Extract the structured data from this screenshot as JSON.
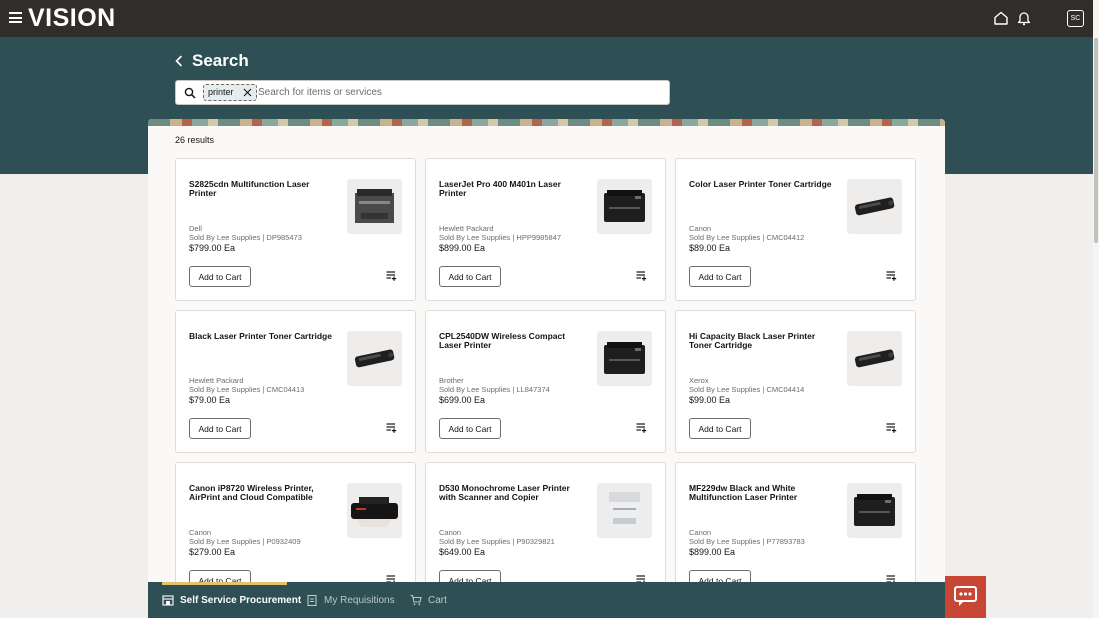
{
  "header": {
    "logo": "VISION",
    "avatar_initials": "SC",
    "icons": [
      "menu-icon",
      "home-icon",
      "bell-icon"
    ]
  },
  "search": {
    "title": "Search",
    "chip": "printer",
    "placeholder": "Search for items or services"
  },
  "results": {
    "count_label": "26 results",
    "items": [
      {
        "title": "S2825cdn Multifunction Laser Printer",
        "brand": "Dell",
        "seller": "Sold By Lee Supplies | DP985473",
        "price": "$799.00 Ea",
        "image": "laser-printer-grey",
        "button": "Add to Cart"
      },
      {
        "title": "LaserJet Pro 400 M401n Laser Printer",
        "brand": "Hewlett Packard",
        "seller": "Sold By Lee Supplies | HPP9985847",
        "price": "$899.00 Ea",
        "image": "laser-printer-black",
        "button": "Add to Cart"
      },
      {
        "title": "Color Laser Printer Toner Cartridge",
        "brand": "Canon",
        "seller": "Sold By Lee Supplies | CMC04412",
        "price": "$89.00 Ea",
        "image": "toner-cartridge",
        "button": "Add to Cart"
      },
      {
        "title": "Black Laser Printer Toner Cartridge",
        "brand": "Hewlett Packard",
        "seller": "Sold By Lee Supplies | CMC04413",
        "price": "$79.00 Ea",
        "image": "toner-cartridge",
        "button": "Add to Cart"
      },
      {
        "title": "CPL2540DW Wireless Compact Laser Printer",
        "brand": "Brother",
        "seller": "Sold By Lee Supplies | LL847374",
        "price": "$699.00 Ea",
        "image": "laser-printer-black",
        "button": "Add to Cart"
      },
      {
        "title": "Hi Capacity Black Laser Printer Toner Cartridge",
        "brand": "Xerox",
        "seller": "Sold By Lee Supplies | CMC04414",
        "price": "$99.00 Ea",
        "image": "toner-cartridge",
        "button": "Add to Cart"
      },
      {
        "title": "Canon iP8720 Wireless Printer, AirPrint and Cloud Compatible",
        "brand": "Canon",
        "seller": "Sold By Lee Supplies | P0932409",
        "price": "$279.00 Ea",
        "image": "inkjet-printer",
        "button": "Add to Cart"
      },
      {
        "title": "D530 Monochrome Laser Printer with Scanner and Copier",
        "brand": "Canon",
        "seller": "Sold By Lee Supplies | P90329821",
        "price": "$649.00 Ea",
        "image": "laser-printer-white",
        "button": "Add to Cart"
      },
      {
        "title": "MF229dw Black and White Multifunction Laser Printer",
        "brand": "Canon",
        "seller": "Sold By Lee Supplies | P77893783",
        "price": "$899.00 Ea",
        "image": "laser-printer-black",
        "button": "Add to Cart"
      }
    ]
  },
  "bottom_nav": {
    "tabs": [
      {
        "label": "Self Service Procurement",
        "icon": "store-icon",
        "active": true
      },
      {
        "label": "My Requisitions",
        "icon": "clipboard-icon",
        "active": false
      },
      {
        "label": "Cart",
        "icon": "cart-icon",
        "active": false
      }
    ]
  },
  "chat": {
    "icon": "chat-icon"
  },
  "colors": {
    "header": "#312d2a",
    "hero": "#2e4f54",
    "active_tab_bar": "#e2c26b",
    "chat_button": "#c74634"
  }
}
